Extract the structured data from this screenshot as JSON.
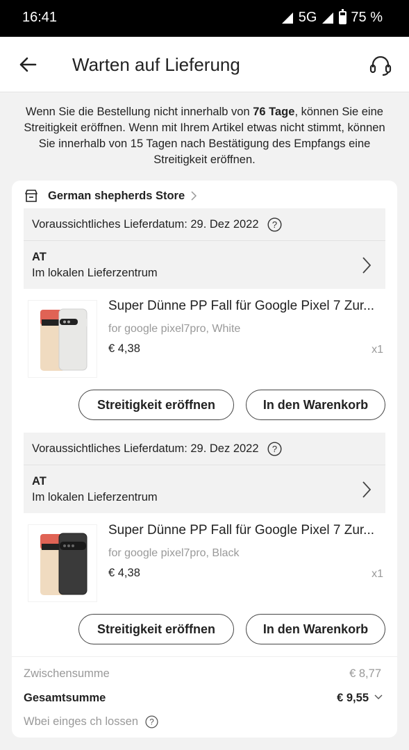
{
  "status_bar": {
    "time": "16:41",
    "network": "5G",
    "battery": "75 %"
  },
  "header": {
    "title": "Warten auf Lieferung"
  },
  "notice": {
    "part1": "Wenn Sie die Bestellung nicht innerhalb von ",
    "days_bold": "76 Tage",
    "part2": ", können Sie eine Streitigkeit eröffnen. Wenn mit Ihrem Artikel etwas nicht stimmt, können Sie innerhalb von 15 Tagen nach Bestätigung des Empfangs eine Streitigkeit eröffnen."
  },
  "store": {
    "name": "German shepherds Store"
  },
  "items": [
    {
      "delivery_date": "Voraussichtliches Lieferdatum: 29. Dez 2022",
      "country": "AT",
      "status": "Im lokalen Lieferzentrum",
      "product_name": "Super Dünne PP Fall für Google Pixel 7 Zur...",
      "variant": "for google pixel7pro, White",
      "price": "€ 4,38",
      "quantity": "x1",
      "case_color": "#ececea",
      "dispute_label": "Streitigkeit eröffnen",
      "cart_label": "In den Warenkorb"
    },
    {
      "delivery_date": "Voraussichtliches Lieferdatum: 29. Dez 2022",
      "country": "AT",
      "status": "Im lokalen Lieferzentrum",
      "product_name": "Super Dünne PP Fall für Google Pixel 7 Zur...",
      "variant": "for google pixel7pro, Black",
      "price": "€ 4,38",
      "quantity": "x1",
      "case_color": "#3a3a3a",
      "dispute_label": "Streitigkeit eröffnen",
      "cart_label": "In den Warenkorb"
    }
  ],
  "summary": {
    "subtotal_label": "Zwischensumme",
    "subtotal_value": "€ 8,77",
    "total_label": "Gesamtsumme",
    "total_value": "€ 9,55",
    "savings_label": "Wbei einges ch lossen"
  }
}
